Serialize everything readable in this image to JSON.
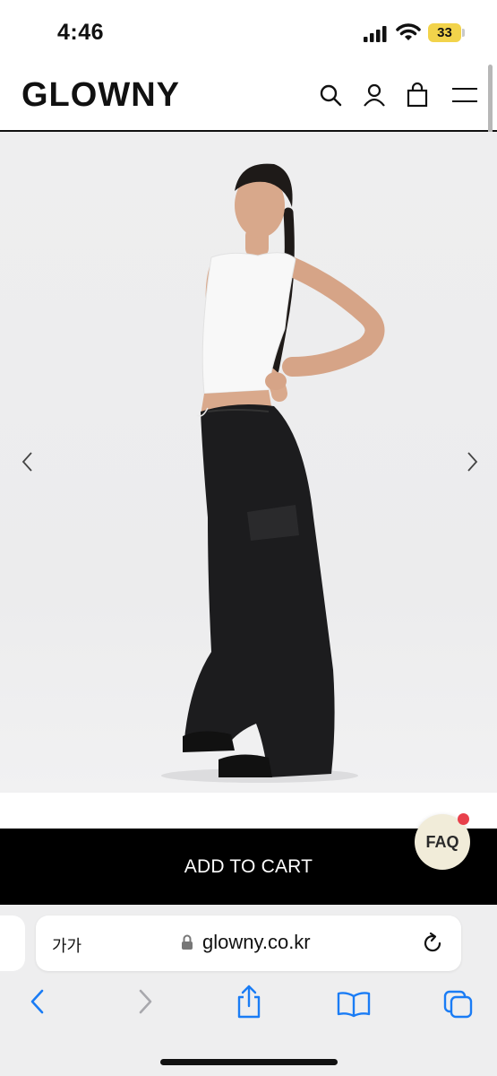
{
  "status_bar": {
    "time": "4:46",
    "battery": "33",
    "battery_color": "#f2d34b"
  },
  "header": {
    "logo": "GLOWNY",
    "icons": [
      "search-icon",
      "account-icon",
      "shopping-bag-icon",
      "menu-icon"
    ]
  },
  "product": {
    "image_alt": "",
    "background": "#eeeeef",
    "carousel": {
      "prev_icon": "chevron-left-icon",
      "next_icon": "chevron-right-icon"
    }
  },
  "cart": {
    "add_to_cart_label": "ADD TO CART"
  },
  "faq": {
    "label": "FAQ",
    "badge_color": "#e8404b"
  },
  "browser": {
    "text_size_label": "가가",
    "url": "glowny.co.kr",
    "toolbar_icons": [
      "back-icon",
      "forward-icon",
      "share-icon",
      "bookmarks-icon",
      "tabs-icon"
    ],
    "accent": "#1a7cf5"
  }
}
